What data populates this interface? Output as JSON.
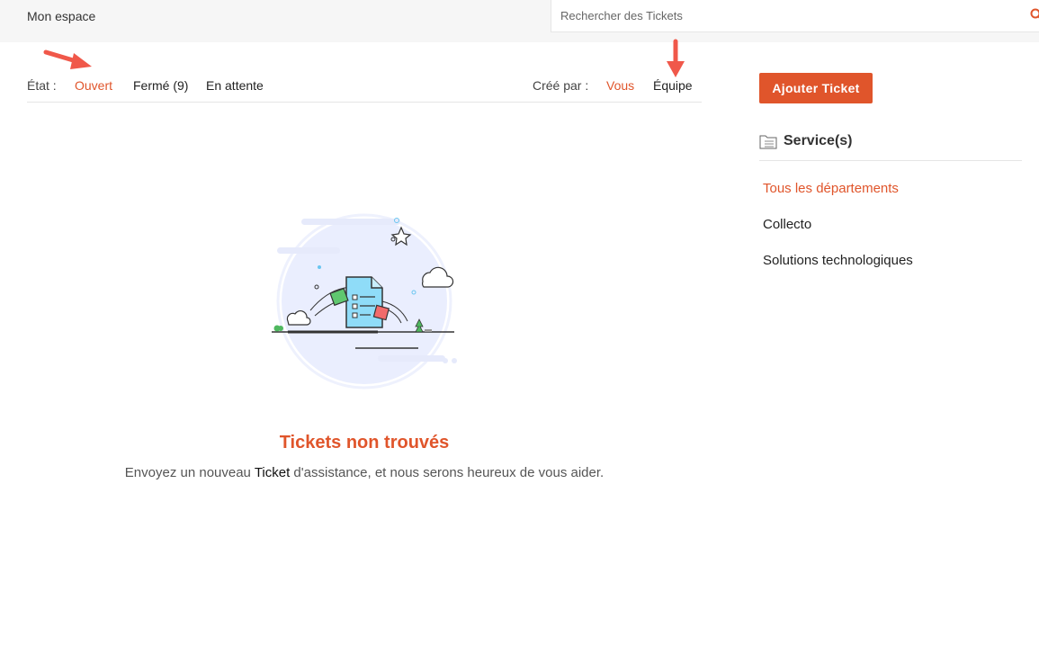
{
  "header": {
    "brand": "Mon espace",
    "search_placeholder": "Rechercher des Tickets"
  },
  "filters": {
    "state_label": "État :",
    "state_items": [
      "Ouvert",
      "Fermé (9)",
      "En attente"
    ],
    "created_label": "Créé par :",
    "created_items": [
      "Vous",
      "Équipe"
    ]
  },
  "empty_state": {
    "title": "Tickets non trouvés",
    "subtitle_before": "Envoyez un nouveau ",
    "subtitle_highlight": "Ticket",
    "subtitle_after": " d'assistance, et nous serons heureux de vous aider."
  },
  "sidebar": {
    "add_button": "Ajouter Ticket",
    "services_title": "Service(s)",
    "departments": [
      "Tous les départements",
      "Collecto",
      "Solutions technologiques"
    ]
  },
  "colors": {
    "accent": "#e0552b",
    "annotation_arrow": "#f0584a"
  },
  "icons": [
    "search-icon",
    "folder-icon",
    "arrow-annotation"
  ]
}
